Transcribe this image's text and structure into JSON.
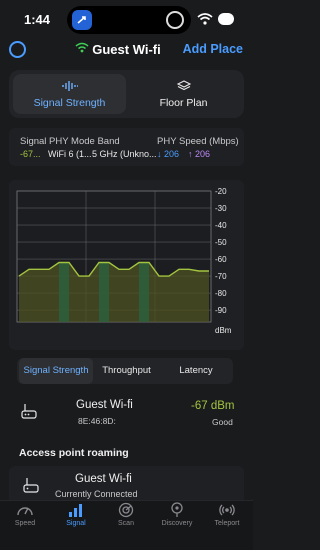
{
  "status": {
    "time": "1:44"
  },
  "nav": {
    "title": "Guest Wi-fi",
    "add_place": "Add Place"
  },
  "view_toggle": {
    "left": "Signal Strength",
    "right": "Floor Plan",
    "selected": "Signal Strength"
  },
  "phy": {
    "header_left": "Signal PHY Mode Band",
    "header_right": "PHY Speed (Mbps)",
    "signal": "-67...",
    "phy_mode": "WiFi 6 (1...",
    "band": "5 GHz (Unkno...",
    "speed_down": "↓ 206",
    "speed_up": "↑ 206"
  },
  "chart_data": {
    "type": "area",
    "y_ticks": [
      "-20",
      "-30",
      "-40",
      "-50",
      "-60",
      "-70",
      "-80",
      "-90",
      "dBm"
    ],
    "ylim": [
      -97,
      -20
    ],
    "grid": true,
    "series": [
      {
        "values": [
          -70,
          -66,
          -66,
          -66,
          -62,
          -62,
          -70,
          -70,
          -62,
          -62,
          -66,
          -66,
          -62,
          -62,
          -70,
          -70,
          -66,
          -66,
          -67,
          -67
        ]
      }
    ],
    "colors": {
      "line": "#a3c441",
      "fill": "#4d5220",
      "spike": "#2f5e3b"
    }
  },
  "metric_tabs": [
    "Signal Strength",
    "Throughput",
    "Latency"
  ],
  "network": {
    "name": "Guest Wi-fi",
    "bssid": "8E:46:8D:",
    "rssi": "-67 dBm",
    "quality": "Good"
  },
  "roaming": {
    "title": "Access point roaming",
    "name": "Guest Wi-fi",
    "status": "Currently Connected"
  },
  "tabbar": [
    {
      "label": "Speed",
      "icon": "speedometer-icon",
      "active": false
    },
    {
      "label": "Signal",
      "icon": "signal-bars-icon",
      "active": true
    },
    {
      "label": "Scan",
      "icon": "radar-icon",
      "active": false
    },
    {
      "label": "Discovery",
      "icon": "magnifier-icon",
      "active": false
    },
    {
      "label": "Teleport",
      "icon": "teleport-icon",
      "active": false
    }
  ]
}
